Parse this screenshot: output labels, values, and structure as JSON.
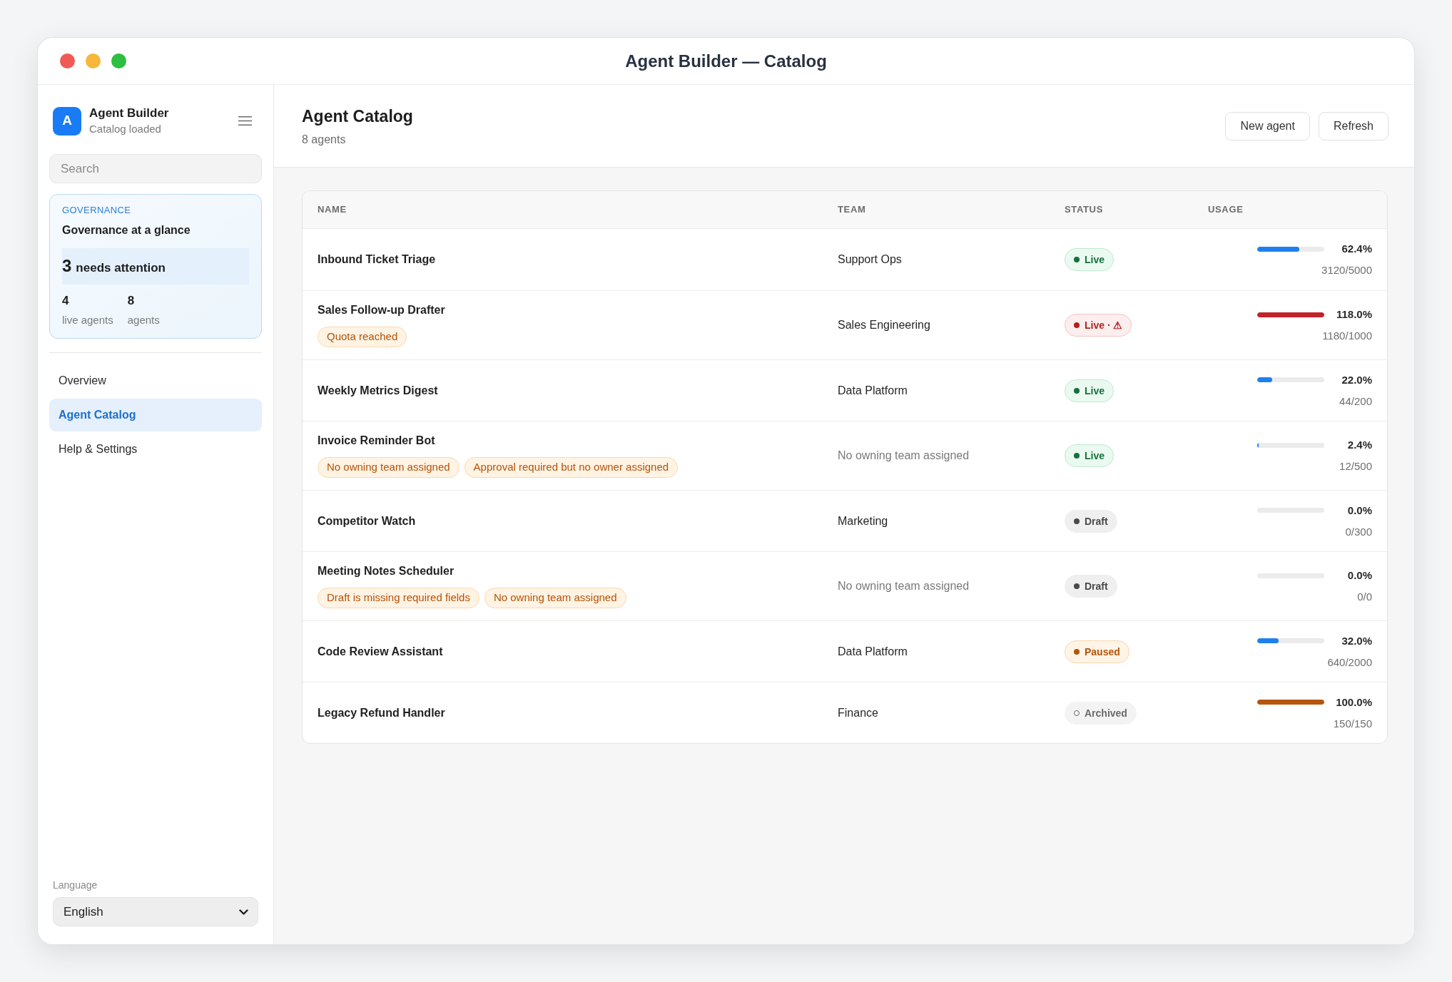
{
  "window": {
    "title": "Agent Builder — Catalog"
  },
  "sidebar": {
    "logo_letter": "A",
    "app_name": "Agent Builder",
    "app_status": "Catalog loaded",
    "search": {
      "placeholder": "Search"
    },
    "governance": {
      "eyebrow": "GOVERNANCE",
      "title": "Governance at a glance",
      "attention_count": "3",
      "attention_label": "needs attention",
      "stats": [
        {
          "value": "4",
          "label": "live agents"
        },
        {
          "value": "8",
          "label": "agents"
        }
      ]
    },
    "nav": [
      {
        "label": "Overview",
        "selected": false
      },
      {
        "label": "Agent Catalog",
        "selected": true
      },
      {
        "label": "Help & Settings",
        "selected": false
      }
    ],
    "language": {
      "label": "Language",
      "value": "English"
    }
  },
  "header": {
    "title": "Agent Catalog",
    "subtitle": "8 agents",
    "actions": [
      "New agent",
      "Refresh"
    ]
  },
  "table": {
    "columns": [
      "NAME",
      "TEAM",
      "STATUS",
      "USAGE"
    ],
    "rows": [
      {
        "name": "Inbound Ticket Triage",
        "team": {
          "name": "Support Ops",
          "assigned": true
        },
        "status": {
          "kind": "live",
          "label": "Live"
        },
        "usage": {
          "level": 0.624,
          "percent": "62.4%",
          "count": "3120/5000",
          "color": "#1f80ed"
        }
      },
      {
        "name": "Sales Follow-up Drafter",
        "tags": [
          "Quota reached"
        ],
        "team": {
          "name": "Sales Engineering",
          "assigned": true
        },
        "status": {
          "kind": "live_alert",
          "label": "Live · ⚠"
        },
        "usage": {
          "level": 1.0,
          "percent": "118.0%",
          "count": "1180/1000",
          "color": "#c0232b"
        }
      },
      {
        "name": "Weekly Metrics Digest",
        "team": {
          "name": "Data Platform",
          "assigned": true
        },
        "status": {
          "kind": "live",
          "label": "Live"
        },
        "usage": {
          "level": 0.22,
          "percent": "22.0%",
          "count": "44/200",
          "color": "#1f80ed"
        }
      },
      {
        "name": "Invoice Reminder Bot",
        "tags": [
          "No owning team assigned",
          "Approval required but no owner assigned"
        ],
        "team": {
          "name": "No owning team assigned",
          "assigned": false
        },
        "status": {
          "kind": "live",
          "label": "Live"
        },
        "usage": {
          "level": 0.024,
          "percent": "2.4%",
          "count": "12/500",
          "color": "#1f80ed"
        }
      },
      {
        "name": "Competitor Watch",
        "team": {
          "name": "Marketing",
          "assigned": true
        },
        "status": {
          "kind": "draft",
          "label": "Draft"
        },
        "usage": {
          "percent": "0.0%",
          "count": "0/300"
        }
      },
      {
        "name": "Meeting Notes Scheduler",
        "tags": [
          "Draft is missing required fields",
          "No owning team assigned"
        ],
        "team": {
          "name": "No owning team assigned",
          "assigned": false
        },
        "status": {
          "kind": "draft",
          "label": "Draft"
        },
        "usage": {
          "percent": "0.0%",
          "count": "0/0"
        }
      },
      {
        "name": "Code Review Assistant",
        "team": {
          "name": "Data Platform",
          "assigned": true
        },
        "status": {
          "kind": "paused",
          "label": "Paused"
        },
        "usage": {
          "level": 0.32,
          "percent": "32.0%",
          "count": "640/2000",
          "color": "#1f80ed"
        }
      },
      {
        "name": "Legacy Refund Handler",
        "team": {
          "name": "Finance",
          "assigned": true
        },
        "status": {
          "kind": "archived",
          "label": "Archived"
        },
        "usage": {
          "level": 1.0,
          "percent": "100.0%",
          "count": "150/150",
          "color": "#b5560f"
        }
      }
    ]
  }
}
